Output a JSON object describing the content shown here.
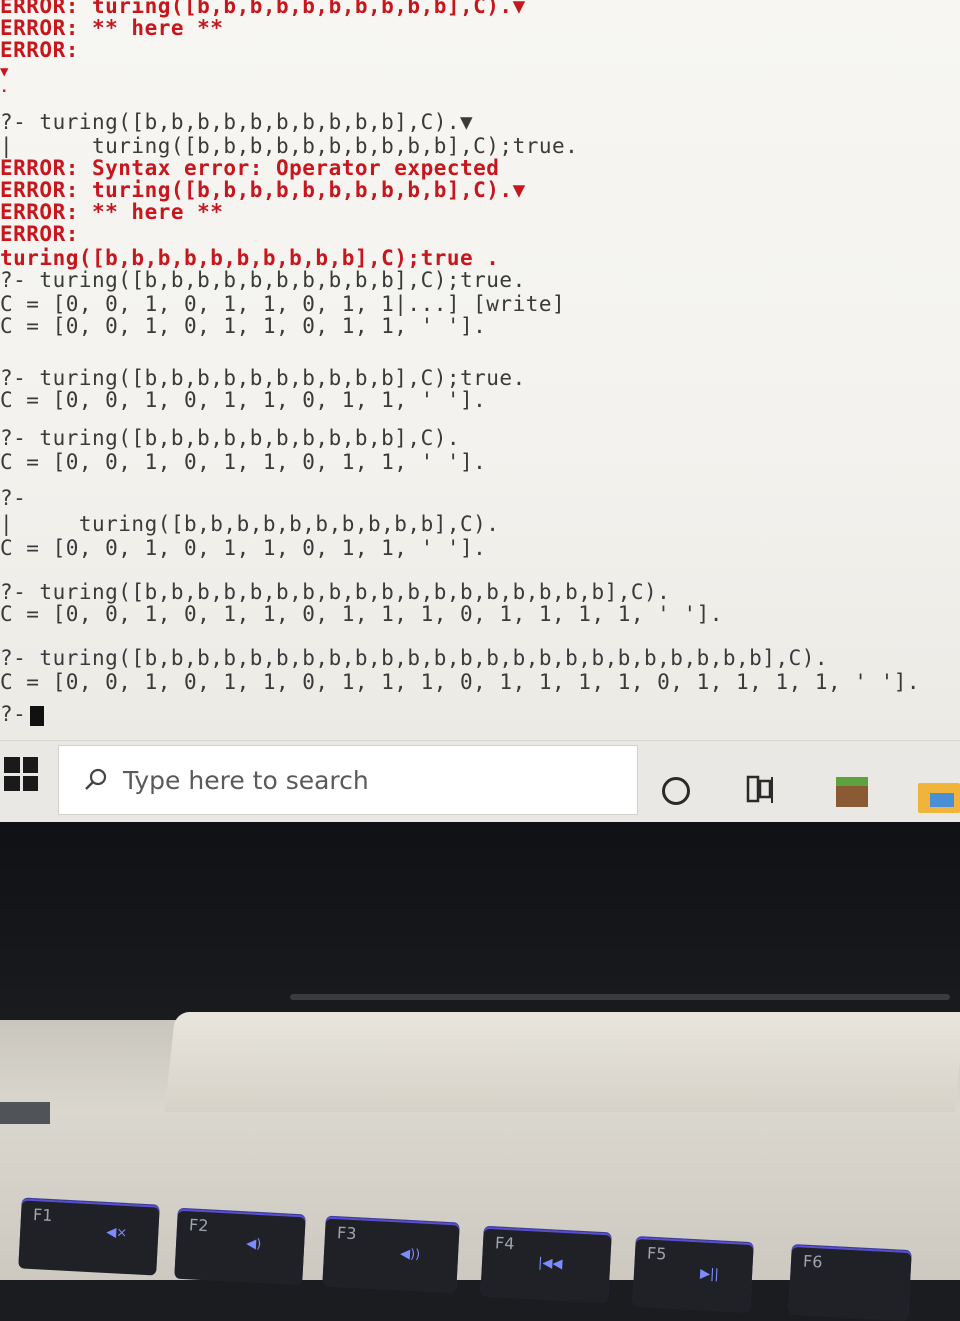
{
  "console": {
    "lines": [
      {
        "kind": "err",
        "text": "ERROR: turing([b,b,b,b,b,b,b,b,b,b],C).▼"
      },
      {
        "kind": "err",
        "text": "ERROR: ** here **"
      },
      {
        "kind": "err",
        "text": "ERROR:"
      },
      {
        "kind": "err",
        "text": "▼"
      },
      {
        "kind": "err",
        "text": "."
      },
      {
        "kind": "out",
        "text": "?- turing([b,b,b,b,b,b,b,b,b,b],C).▼"
      },
      {
        "kind": "out",
        "text": "|      turing([b,b,b,b,b,b,b,b,b,b],C);true."
      },
      {
        "kind": "err",
        "text": "ERROR: Syntax error: Operator expected"
      },
      {
        "kind": "err",
        "text": "ERROR: turing([b,b,b,b,b,b,b,b,b,b],C).▼"
      },
      {
        "kind": "err",
        "text": "ERROR: ** here **"
      },
      {
        "kind": "err",
        "text": "ERROR:"
      },
      {
        "kind": "err",
        "text": "turing([b,b,b,b,b,b,b,b,b,b],C);true ."
      },
      {
        "kind": "out",
        "text": "?- turing([b,b,b,b,b,b,b,b,b,b],C);true."
      },
      {
        "kind": "out",
        "text": "C = [0, 0, 1, 0, 1, 1, 0, 1, 1|...] [write]"
      },
      {
        "kind": "out",
        "text": "C = [0, 0, 1, 0, 1, 1, 0, 1, 1, ' ']."
      },
      {
        "kind": "out",
        "text": ""
      },
      {
        "kind": "out",
        "text": "?- turing([b,b,b,b,b,b,b,b,b,b],C);true."
      },
      {
        "kind": "out",
        "text": "C = [0, 0, 1, 0, 1, 1, 0, 1, 1, ' ']."
      },
      {
        "kind": "out",
        "text": ""
      },
      {
        "kind": "out",
        "text": "?- turing([b,b,b,b,b,b,b,b,b,b],C)."
      },
      {
        "kind": "out",
        "text": "C = [0, 0, 1, 0, 1, 1, 0, 1, 1, ' ']."
      },
      {
        "kind": "out",
        "text": ""
      },
      {
        "kind": "out",
        "text": "?-"
      },
      {
        "kind": "out",
        "text": "|     turing([b,b,b,b,b,b,b,b,b,b],C)."
      },
      {
        "kind": "out",
        "text": "C = [0, 0, 1, 0, 1, 1, 0, 1, 1, ' ']."
      },
      {
        "kind": "out",
        "text": ""
      },
      {
        "kind": "out",
        "text": "?- turing([b,b,b,b,b,b,b,b,b,b,b,b,b,b,b,b,b,b],C)."
      },
      {
        "kind": "out",
        "text": "C = [0, 0, 1, 0, 1, 1, 0, 1, 1, 1, 0, 1, 1, 1, 1, ' ']."
      },
      {
        "kind": "out",
        "text": ""
      },
      {
        "kind": "out",
        "text": "?- turing([b,b,b,b,b,b,b,b,b,b,b,b,b,b,b,b,b,b,b,b,b,b,b,b],C)."
      },
      {
        "kind": "out",
        "text": "C = [0, 0, 1, 0, 1, 1, 0, 1, 1, 1, 0, 1, 1, 1, 1, 0, 1, 1, 1, 1, ' ']."
      },
      {
        "kind": "out",
        "text": "?- "
      }
    ]
  },
  "taskbar": {
    "search_placeholder": "Type here to search",
    "icons": [
      "windows-start-icon",
      "search-icon",
      "cortana-icon",
      "task-view-icon",
      "minecraft-icon",
      "file-explorer-icon"
    ]
  },
  "keyboard": {
    "keys": [
      {
        "label": "F1",
        "symbol": "mute"
      },
      {
        "label": "F2",
        "symbol": "volume-down"
      },
      {
        "label": "F3",
        "symbol": "volume-up"
      },
      {
        "label": "F4",
        "symbol": "previous-track"
      },
      {
        "label": "F5",
        "symbol": "play-pause"
      },
      {
        "label": "F6",
        "symbol": ""
      }
    ]
  },
  "colors": {
    "error": "#c8161d",
    "console_text": "#2e2e2e",
    "taskbar": "#e9e8e4"
  }
}
